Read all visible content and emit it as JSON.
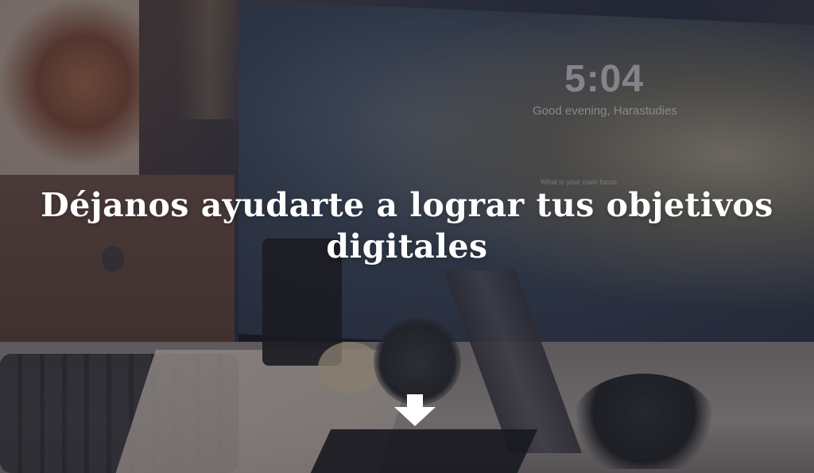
{
  "hero": {
    "headline_line1": "Déjanos ayudarte a lograr tus objetivos",
    "headline_line2": "digitales",
    "scroll_icon": "arrow-down-icon"
  },
  "monitor_screen": {
    "clock": "5:04",
    "greeting": "Good evening, Harastudies",
    "focus_prompt": "What is your main focus"
  },
  "colors": {
    "headline": "#ffffff",
    "overlay": "#1e1a2e",
    "arrow": "#ffffff"
  }
}
